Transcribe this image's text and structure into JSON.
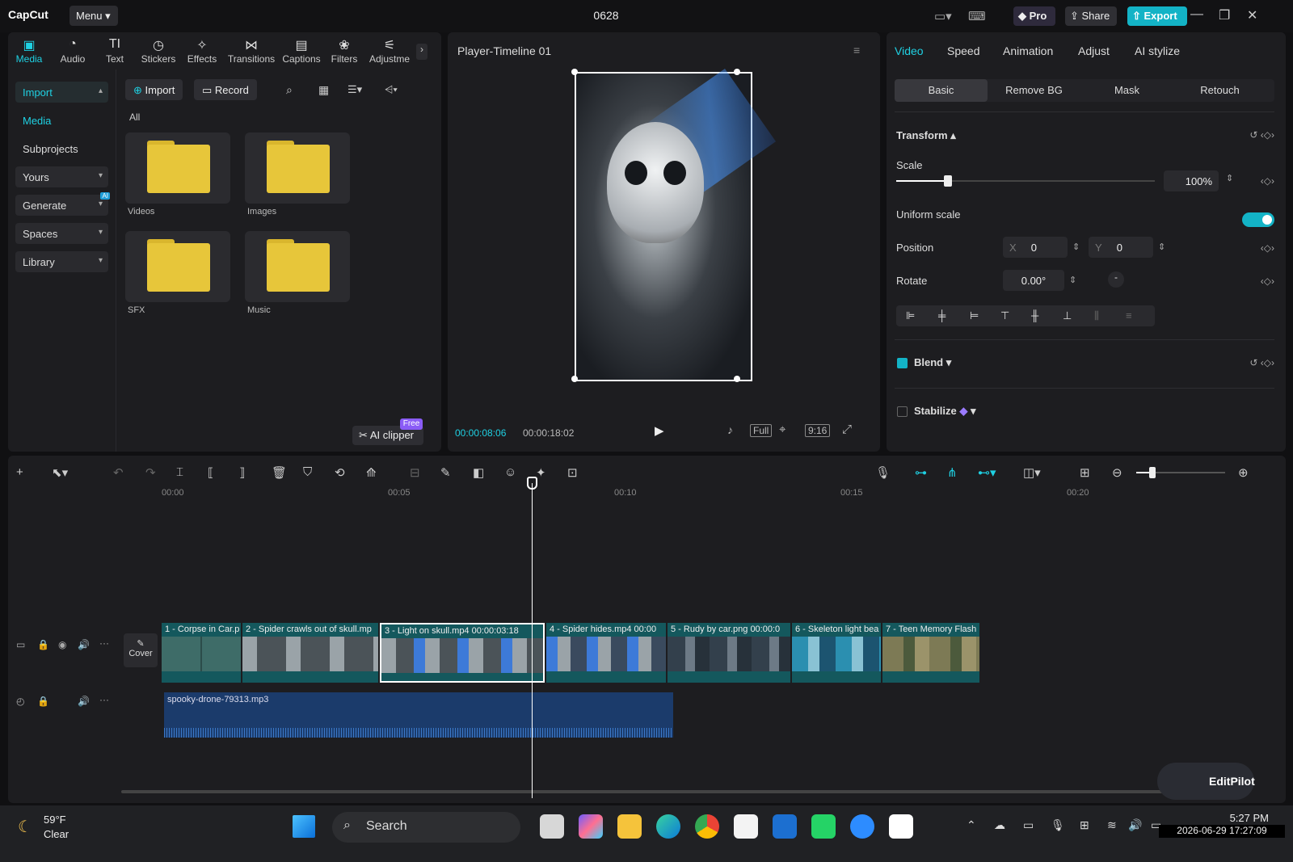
{
  "app": {
    "logo": "CapCut",
    "menu_label": "Menu",
    "project_title": "0628"
  },
  "titlebar": {
    "pro_label": "Pro",
    "share_label": "Share",
    "export_label": "Export"
  },
  "tools": [
    {
      "label": "Media",
      "icon": "media-icon"
    },
    {
      "label": "Audio",
      "icon": "audio-icon"
    },
    {
      "label": "Text",
      "icon": "text-icon"
    },
    {
      "label": "Stickers",
      "icon": "stickers-icon"
    },
    {
      "label": "Effects",
      "icon": "effects-icon"
    },
    {
      "label": "Transitions",
      "icon": "transitions-icon"
    },
    {
      "label": "Captions",
      "icon": "captions-icon"
    },
    {
      "label": "Filters",
      "icon": "filters-icon"
    },
    {
      "label": "Adjustme",
      "icon": "adjustment-icon"
    }
  ],
  "sidebar": {
    "import": "Import",
    "media": "Media",
    "subprojects": "Subprojects",
    "yours": "Yours",
    "generate": "Generate",
    "generate_badge": "AI",
    "spaces": "Spaces",
    "library": "Library"
  },
  "media": {
    "import_btn": "Import",
    "record_btn": "Record",
    "filter_all": "All",
    "folders": [
      "Videos",
      "Images",
      "SFX",
      "Music"
    ],
    "ai_clipper": "AI clipper",
    "free_badge": "Free"
  },
  "player": {
    "title": "Player-Timeline 01",
    "current_time": "00:00:08:06",
    "total_time": "00:00:18:02",
    "full_label": "Full",
    "ratio_label": "9:16"
  },
  "props": {
    "tabs": [
      "Video",
      "Speed",
      "Animation",
      "Adjust",
      "AI stylize"
    ],
    "subtabs": [
      "Basic",
      "Remove BG",
      "Mask",
      "Retouch"
    ],
    "transform": "Transform",
    "scale_label": "Scale",
    "scale_value": "100%",
    "scale_fraction": 0.2,
    "uniform_scale": "Uniform scale",
    "position_label": "Position",
    "pos_x_label": "X",
    "pos_x": "0",
    "pos_y_label": "Y",
    "pos_y": "0",
    "rotate_label": "Rotate",
    "rotate_value": "0.00°",
    "blend": "Blend",
    "stabilize": "Stabilize"
  },
  "timeline": {
    "ruler": [
      "00:00",
      "00:05",
      "00:10",
      "00:15",
      "00:20"
    ],
    "cover_label": "Cover",
    "clips": [
      {
        "label": "1 - Corpse in Car.p"
      },
      {
        "label": "2 - Spider crawls out of skull.mp"
      },
      {
        "label": "3 - Light on skull.mp4   00:00:03:18"
      },
      {
        "label": "4 - Spider hides.mp4   00:00"
      },
      {
        "label": "5 - Rudy by car.png   00:00:0"
      },
      {
        "label": "6 - Skeleton light bea"
      },
      {
        "label": "7 - Teen Memory Flash"
      }
    ],
    "audio_label": "spooky-drone-79313.mp3",
    "editpilot": "EditPilot"
  },
  "taskbar": {
    "temp": "59°F",
    "weather": "Clear",
    "search": "Search",
    "time": "5:27 PM",
    "date": "2026-06-29 17:27:09"
  },
  "colors": {
    "accent": "#13b3c6",
    "folder": "#e7c63a",
    "clip": "#14585d",
    "audio": "#1b3b6b"
  }
}
